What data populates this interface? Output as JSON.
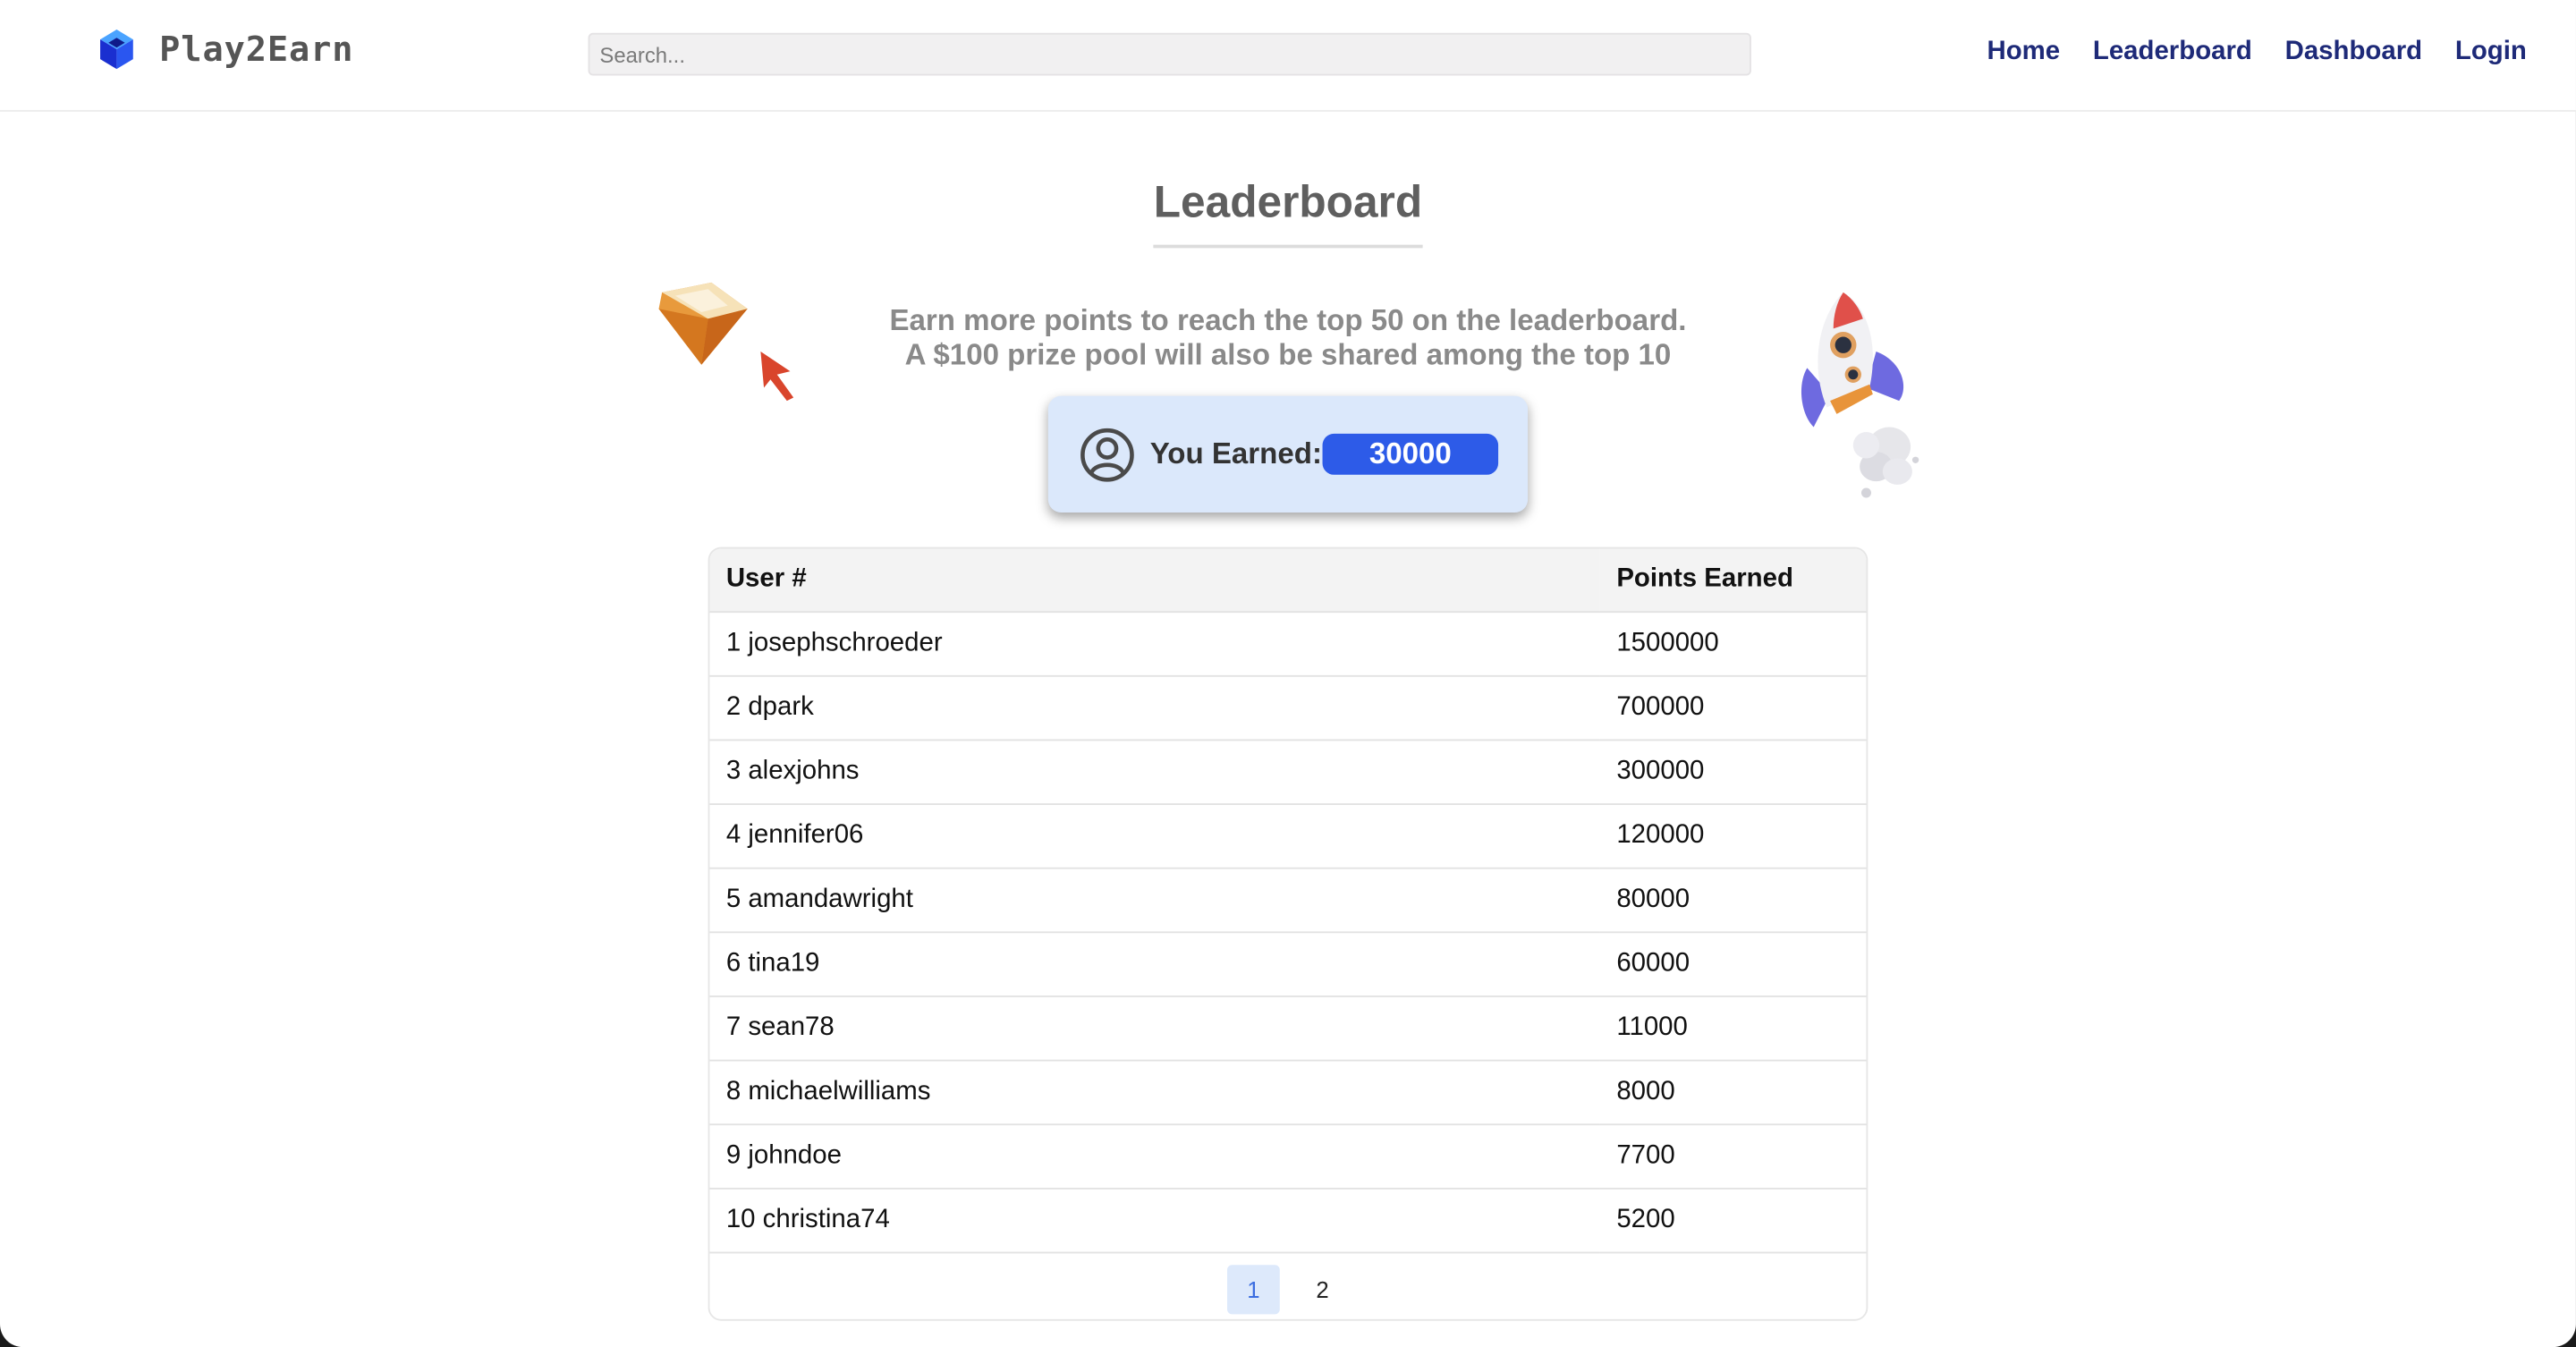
{
  "header": {
    "logo_text": "Play2Earn",
    "search_placeholder": "Search...",
    "nav": [
      "Home",
      "Leaderboard",
      "Dashboard",
      "Login"
    ]
  },
  "main": {
    "title": "Leaderboard",
    "subtitle_line1": "Earn more points to reach the top 50 on the leaderboard.",
    "subtitle_line2": "A $100 prize pool will also be shared among the top 10",
    "earned_label": "You Earned:",
    "earned_value": "30000"
  },
  "table": {
    "headers": [
      "User #",
      "Points Earned"
    ],
    "rows": [
      {
        "user": "1 josephschroeder",
        "points": "1500000"
      },
      {
        "user": "2 dpark",
        "points": "700000"
      },
      {
        "user": "3 alexjohns",
        "points": "300000"
      },
      {
        "user": "4 jennifer06",
        "points": "120000"
      },
      {
        "user": "5 amandawright",
        "points": "80000"
      },
      {
        "user": "6 tina19",
        "points": "60000"
      },
      {
        "user": "7 sean78",
        "points": "11000"
      },
      {
        "user": "8 michaelwilliams",
        "points": "8000"
      },
      {
        "user": "9 johndoe",
        "points": "7700"
      },
      {
        "user": "10 christina74",
        "points": "5200"
      }
    ]
  },
  "pagination": {
    "pages": [
      "1",
      "2"
    ],
    "active": "1"
  },
  "colors": {
    "nav_link": "#1e2a78",
    "accent": "#2d5be8",
    "card_bg": "#dbe8fb"
  },
  "icons": [
    "cube-logo-icon",
    "gem-icon",
    "cursor-arrow-icon",
    "rocket-icon",
    "user-circle-icon"
  ]
}
